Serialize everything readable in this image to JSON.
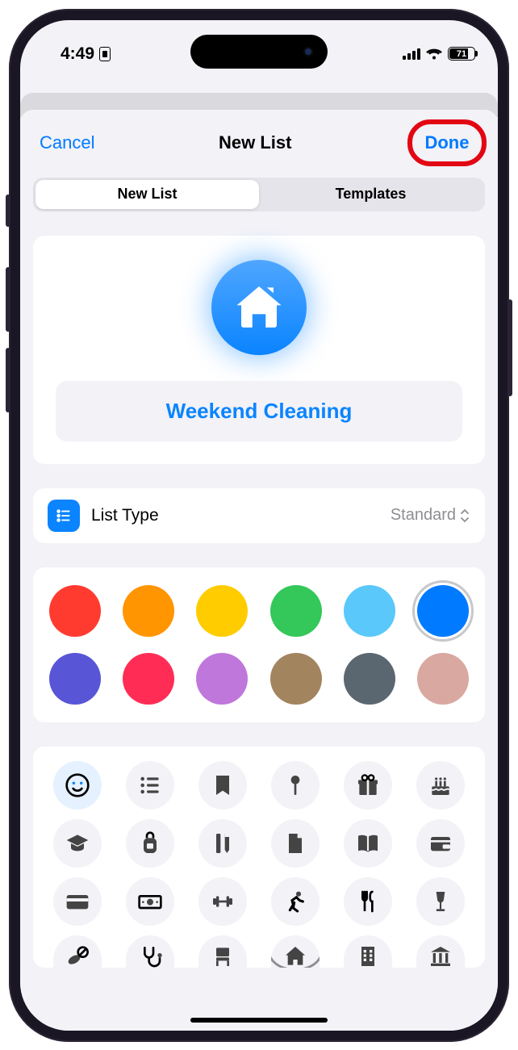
{
  "status": {
    "time": "4:49",
    "battery": "71"
  },
  "nav": {
    "cancel": "Cancel",
    "title": "New List",
    "done": "Done"
  },
  "segmented": {
    "newlist": "New List",
    "templates": "Templates"
  },
  "list": {
    "name": "Weekend Cleaning",
    "icon": "house"
  },
  "listType": {
    "label": "List Type",
    "value": "Standard"
  },
  "colors": {
    "row1": [
      "#ff3b30",
      "#ff9500",
      "#ffcc00",
      "#34c759",
      "#5ac8fa",
      "#007aff"
    ],
    "row2": [
      "#5856d6",
      "#ff2d55",
      "#c077dc",
      "#a2845e",
      "#5b6770",
      "#d9a8a0"
    ],
    "selected": "#007aff"
  },
  "icons": {
    "row1": [
      "smiley",
      "list",
      "bookmark",
      "pin",
      "gift",
      "cake"
    ],
    "row2": [
      "gradcap",
      "backpack",
      "ruler-pencil",
      "document",
      "book",
      "wallet"
    ],
    "row3": [
      "credit-card",
      "cash",
      "dumbbell",
      "running",
      "fork-knife",
      "wineglass"
    ],
    "row4": [
      "pills",
      "stethoscope",
      "chair",
      "house",
      "building",
      "institution"
    ],
    "selectedTop": "smiley",
    "currentBig": "house"
  }
}
